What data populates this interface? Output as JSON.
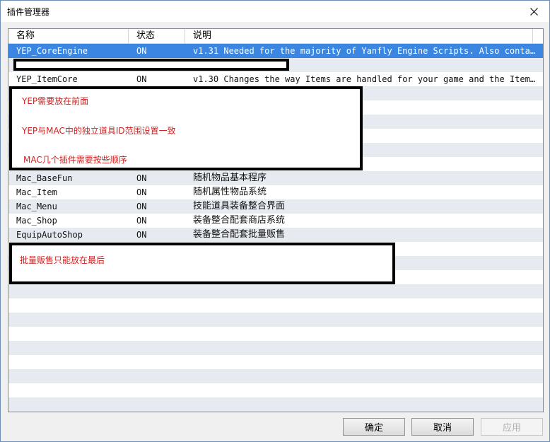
{
  "window": {
    "title": "插件管理器"
  },
  "columns": {
    "name": "名称",
    "status": "状态",
    "description": "说明"
  },
  "rows": [
    {
      "name": "YEP_CoreEngine",
      "status": "ON",
      "description": "v1.31 Needed for the majority of Yanfly Engine Scripts. Also contain…"
    },
    {
      "name": "",
      "status": "",
      "description": ""
    },
    {
      "name": "YEP_ItemCore",
      "status": "ON",
      "description": "v1.30 Changes the way Items are handled for your game and the Item S…"
    },
    {
      "name": "",
      "status": "",
      "description": ""
    },
    {
      "name": "",
      "status": "",
      "description": ""
    },
    {
      "name": "",
      "status": "",
      "description": ""
    },
    {
      "name": "",
      "status": "",
      "description": ""
    },
    {
      "name": "",
      "status": "",
      "description": ""
    },
    {
      "name": "",
      "status": "",
      "description": ""
    },
    {
      "name": "Mac_BaseFun",
      "status": "ON",
      "description": "随机物品基本程序"
    },
    {
      "name": "Mac_Item",
      "status": "ON",
      "description": "随机属性物品系统"
    },
    {
      "name": "Mac_Menu",
      "status": "ON",
      "description": "技能道具装备整合界面"
    },
    {
      "name": "Mac_Shop",
      "status": "ON",
      "description": "装备整合配套商店系统"
    },
    {
      "name": "EquipAutoShop",
      "status": "ON",
      "description": "装备整合配套批量贩售"
    }
  ],
  "annotations": {
    "box1": [
      "YEP需要放在前面",
      "YEP与MAC中的独立道具ID范围设置一致",
      "MAC几个插件需要按些顺序"
    ],
    "box2": [
      "批量贩售只能放在最后"
    ]
  },
  "buttons": {
    "ok": "确定",
    "cancel": "取消",
    "apply": "应用"
  }
}
